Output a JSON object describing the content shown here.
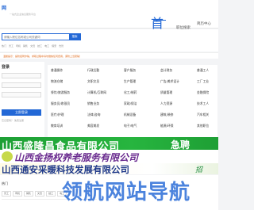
{
  "header": {
    "logo": "网",
    "tagline": "一站式企业信息服务平台",
    "nav": [
      "首页",
      "职位搜索",
      "简历中心"
    ]
  },
  "search": {
    "placeholder": "请输入职位名称或公司关键词",
    "button": "搜索",
    "hot_words": [
      "热门",
      "普工",
      "司机",
      "销售",
      "文员",
      "技工",
      "电工",
      "保安",
      "仓管"
    ]
  },
  "notice": "温馨提示：提防招聘诈骗，求职过程中请勿缴纳任何费用，谨防上当受骗！",
  "sidebar": {
    "title": "登录",
    "button": "立即登录",
    "link": "忘记密码？ 免费注册"
  },
  "categories": [
    [
      "普通操作",
      "行政后勤",
      "客户服务",
      "会计财务",
      "普通工人"
    ],
    [
      "物流仓储",
      "文职文员",
      "生产管理",
      "广告/美术设计",
      "工厂工业"
    ],
    [
      "餐饮/旅游服务",
      "计算机/互联网",
      "化工/制药",
      "质量管理",
      "金融保险"
    ],
    [
      "服务员/收银员",
      "销售业务",
      "家政/保洁",
      "人力资源",
      "技术工人"
    ],
    [
      "医疗/护理",
      "法律/咨询",
      "机械设备",
      "建筑/装修",
      "汽车相关"
    ],
    [
      "教育培训",
      "美容美发",
      "电子/电气",
      "能源/环保",
      "其他职位"
    ]
  ],
  "banners": {
    "banner_1": "山西盛隆昌食品有限公司",
    "banner_1_tag": "急聘",
    "banner_2": "山西金扬权养老服务有限公司",
    "banner_3": "山西通安采暖科技发展有限公司",
    "banner_3_tag": "招"
  },
  "bottom": {
    "label": "热门",
    "tags": [
      "普工",
      "司机",
      "销售",
      "文员",
      "技工",
      "电工"
    ]
  },
  "watermark": "领航网站导航"
}
